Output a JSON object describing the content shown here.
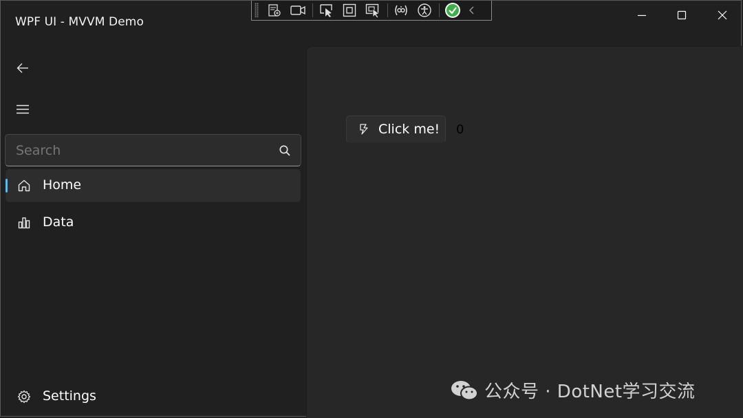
{
  "window": {
    "title": "WPF UI - MVVM Demo",
    "accent_color": "#4cc2ff",
    "background": "#202020",
    "content_background": "#272727"
  },
  "caption_buttons": [
    {
      "name": "minimize",
      "icon": "minimize-icon"
    },
    {
      "name": "maximize",
      "icon": "maximize-icon"
    },
    {
      "name": "close",
      "icon": "close-icon"
    }
  ],
  "dev_toolbar": {
    "icons": [
      "live-visual-tree-icon",
      "record-icon",
      "select-element-icon",
      "display-layout-adorners-icon",
      "track-focus-icon",
      "binding-failures-icon",
      "accessibility-icon",
      "status-ok-icon",
      "collapse-chevron-icon"
    ]
  },
  "navigation": {
    "back_icon": "back-arrow-icon",
    "menu_icon": "hamburger-menu-icon",
    "search": {
      "placeholder": "Search",
      "icon": "search-icon"
    },
    "items": [
      {
        "label": "Home",
        "icon": "home-icon",
        "active": true
      },
      {
        "label": "Data",
        "icon": "bar-chart-icon",
        "active": false
      }
    ],
    "footer_items": [
      {
        "label": "Settings",
        "icon": "gear-icon"
      }
    ]
  },
  "content": {
    "button": {
      "label": "Click me!",
      "icon": "fluent-icon"
    },
    "counter": "0"
  },
  "watermark": {
    "text": "公众号 · DotNet学习交流",
    "icon": "wechat-icon"
  }
}
